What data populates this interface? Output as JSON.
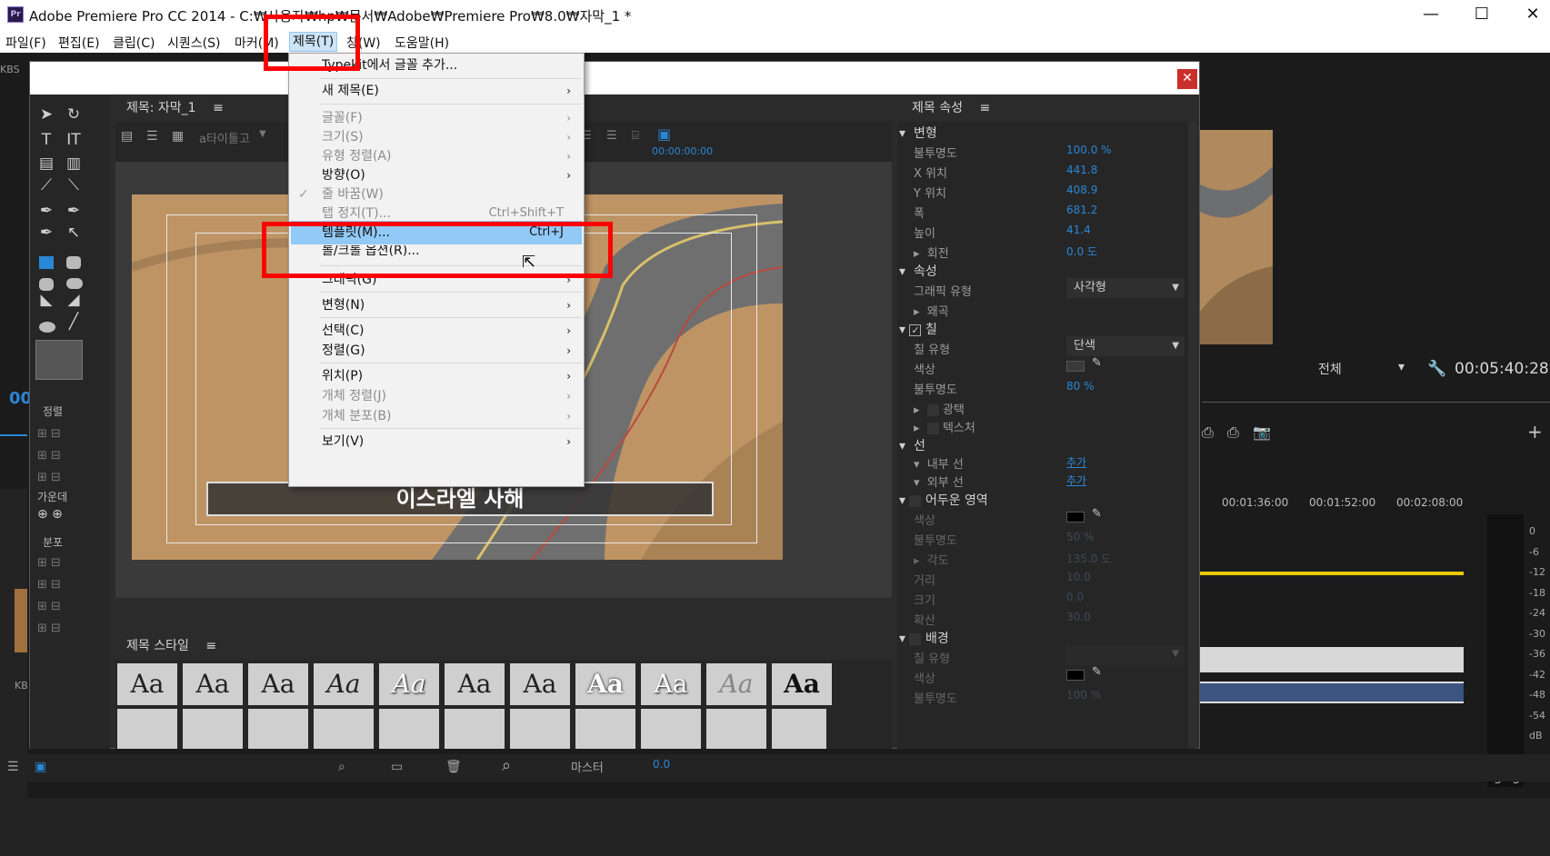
{
  "window": {
    "title": "Adobe Premiere Pro CC 2014 - C:₩사용자₩hp₩문서₩Adobe₩Premiere Pro₩8.0₩자막_1 *",
    "app_badge": "Pr",
    "minimize": "—",
    "maximize": "☐",
    "close": "✕"
  },
  "menubar": [
    "파일(F)",
    "편집(E)",
    "클립(C)",
    "시퀀스(S)",
    "마커(M)",
    "제목(T)",
    "창(W)",
    "도움말(H)"
  ],
  "title_menu": {
    "items": [
      {
        "label": "Typekit에서 글꼴 추가...",
        "enabled": true
      },
      {
        "label": "새 제목(E)",
        "enabled": true,
        "submenu": true
      },
      {
        "label": "글꼴(F)",
        "enabled": false,
        "submenu": true
      },
      {
        "label": "크기(S)",
        "enabled": false,
        "submenu": true
      },
      {
        "label": "유형 정렬(A)",
        "enabled": false,
        "submenu": true
      },
      {
        "label": "방향(O)",
        "enabled": true,
        "submenu": true
      },
      {
        "label": "줄 바꿈(W)",
        "enabled": false,
        "checked": true
      },
      {
        "label": "탭 정지(T)...",
        "enabled": false,
        "shortcut": "Ctrl+Shift+T"
      },
      {
        "label": "템플릿(M)...",
        "enabled": true,
        "shortcut": "Ctrl+J",
        "highlighted": true
      },
      {
        "label": "롤/크롤 옵션(R)...",
        "enabled": true
      },
      {
        "label": "그래픽(G)",
        "enabled": true,
        "submenu": true
      },
      {
        "label": "변형(N)",
        "enabled": true,
        "submenu": true
      },
      {
        "label": "선택(C)",
        "enabled": true,
        "submenu": true
      },
      {
        "label": "정렬(G)",
        "enabled": true,
        "submenu": true
      },
      {
        "label": "위치(P)",
        "enabled": true,
        "submenu": true
      },
      {
        "label": "개체 정렬(J)",
        "enabled": false,
        "submenu": true
      },
      {
        "label": "개체 분포(B)",
        "enabled": false,
        "submenu": true
      },
      {
        "label": "보기(V)",
        "enabled": true,
        "submenu": true
      }
    ]
  },
  "titler": {
    "panel_title": "제목: 자막_1",
    "font_dropdown": "a타이틀고",
    "timecode": "00:00:00:00",
    "caption_text": "이스라엘 사해",
    "align_label": "정렬",
    "center_label": "가운데",
    "distribute_label": "분포",
    "styles_panel_title": "제목 스타일",
    "styles": [
      "Aa",
      "Aa",
      "Aa",
      "Aa",
      "Aa",
      "Aa",
      "Aa",
      "Aa",
      "Aa",
      "Aa",
      "Aa"
    ]
  },
  "properties": {
    "panel_title": "제목 속성",
    "transform": {
      "section": "변형",
      "rows": [
        {
          "label": "불투명도",
          "value": "100.0 %"
        },
        {
          "label": "X 위치",
          "value": "441.8"
        },
        {
          "label": "Y 위치",
          "value": "408.9"
        },
        {
          "label": "폭",
          "value": "681.2"
        },
        {
          "label": "높이",
          "value": "41.4"
        },
        {
          "label": "회전",
          "value": "0.0 도"
        }
      ]
    },
    "attributes": {
      "section": "속성",
      "graphic_type_label": "그래픽 유형",
      "graphic_type_value": "사각형",
      "distort": "왜곡"
    },
    "fill": {
      "section": "칠",
      "fill_type_label": "칠 유형",
      "fill_type_value": "단색",
      "color_label": "색상",
      "opacity_label": "불투명도",
      "opacity_value": "80 %",
      "sheen": "광택",
      "texture": "텍스처"
    },
    "strokes": {
      "section": "선",
      "inner": "내부 선",
      "outer": "외부 선",
      "add": "추가"
    },
    "shadow": {
      "section": "어두운 영역",
      "color_label": "색상",
      "opacity_label": "불투명도",
      "opacity_value": "50 %",
      "angle_label": "각도",
      "angle_value": "135.0 도",
      "distance_label": "거리",
      "distance_value": "10.0",
      "size_label": "크기",
      "size_value": "0.0",
      "spread_label": "확산",
      "spread_value": "30.0"
    },
    "background": {
      "section": "배경",
      "fill_type_label": "칠 유형",
      "color_label": "색상",
      "opacity_label": "불투명도",
      "opacity_value": "100 %"
    }
  },
  "background_app": {
    "kbs": "KBS",
    "kb": "KB",
    "program_dropdown": "전체",
    "program_timecode": "00:05:40:28",
    "timeline_ticks": [
      "00:01:36:00",
      "00:01:52:00",
      "00:02:08:00"
    ],
    "audio_scale": [
      "0",
      "-6",
      "-12",
      "-18",
      "-24",
      "-30",
      "-36",
      "-42",
      "-48",
      "-54",
      "dB"
    ],
    "audio_solo": [
      "S",
      "S"
    ],
    "master_label": "마스터",
    "master_value": "0.0",
    "source_timecode": "00"
  },
  "colors": {
    "accent_blue": "#2a86d6",
    "highlight_red": "#ff0000",
    "menu_highlight": "#91c9f7",
    "timeline_yellow": "#e8c800"
  }
}
